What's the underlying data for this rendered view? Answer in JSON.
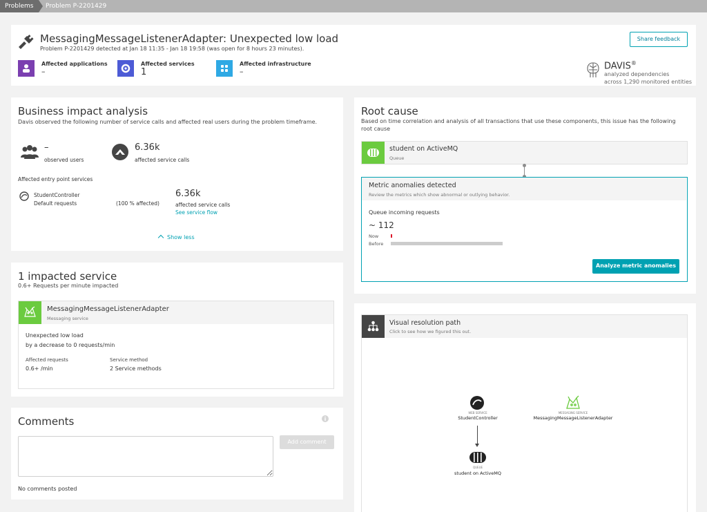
{
  "breadcrumb": {
    "root": "Problems",
    "current": "Problem P-2201429"
  },
  "header": {
    "title": "MessagingMessageListenerAdapter: Unexpected low load",
    "subtitle": "Problem P-2201429 detected at Jan 18 11:35 - Jan 18 19:58 (was open for 8 hours 23 minutes).",
    "share_feedback": "Share feedback",
    "affected": [
      {
        "label": "Affected applications",
        "value": "–",
        "color": "#7b3fb0"
      },
      {
        "label": "Affected services",
        "value": "1",
        "color": "#4d5bd6"
      },
      {
        "label": "Affected infrastructure",
        "value": "–",
        "color": "#2fa9e4"
      }
    ],
    "davis": {
      "name": "DAVIS",
      "mark": "®",
      "line1": "analyzed dependencies",
      "line2": "across 1,290 monitored entities"
    }
  },
  "business": {
    "title": "Business impact analysis",
    "desc": "Davis observed the following number of service calls and affected real users during the problem timeframe.",
    "users_value": "–",
    "users_label": "observed users",
    "calls_value": "6.36k",
    "calls_label": "affected service calls",
    "entry_heading": "Affected entry point services",
    "entry_name": "StudentController",
    "entry_sub": "Default requests",
    "entry_pct": "(100 % affected)",
    "entry_calls": "6.36k",
    "entry_calls_label": "affected service calls",
    "entry_link": "See service flow",
    "show_less": "Show less"
  },
  "impacted": {
    "title": "1 impacted service",
    "subtitle": "0.6+ Requests per minute impacted",
    "service_name": "MessagingMessageListenerAdapter",
    "service_type": "Messaging service",
    "issue_line1": "Unexpected low load",
    "issue_line2": "by a decrease to 0 requests/min",
    "affected_requests_label": "Affected requests",
    "affected_requests_value": "0.6+ /min",
    "service_method_label": "Service method",
    "service_method_value": "2 Service methods"
  },
  "comments": {
    "title": "Comments",
    "add_button": "Add comment",
    "empty": "No comments posted",
    "placeholder": ""
  },
  "root_cause": {
    "title": "Root cause",
    "desc_line1": "Based on time correlation and analysis of all transactions that use these components, this issue has the following",
    "desc_line2": "root cause",
    "entity_name": "student on ActiveMQ",
    "entity_type": "Queue",
    "anomalies_title": "Metric anomalies detected",
    "anomalies_desc": "Review the metrics which show abnormal or outlying behavior.",
    "metric_name": "Queue incoming requests",
    "metric_value": "~ 112",
    "now_label": "Now",
    "before_label": "Before",
    "now_fraction": 0.0,
    "before_fraction": 1.0,
    "analyze_button": "Analyze metric anomalies"
  },
  "resolution": {
    "title": "Visual resolution path",
    "subtitle": "Click to see how we figured this out.",
    "nodes": [
      {
        "type": "WEB SERVICE",
        "name": "StudentController"
      },
      {
        "type": "MESSAGING SERVICE",
        "name": "MessagingMessageListenerAdapter"
      },
      {
        "type": "QUEUE",
        "name": "student on ActiveMQ"
      }
    ]
  },
  "colors": {
    "accent": "#00a1b2",
    "green": "#6bcb3f",
    "teal_border": "#00a1b2",
    "alert_red": "#dc172a"
  }
}
